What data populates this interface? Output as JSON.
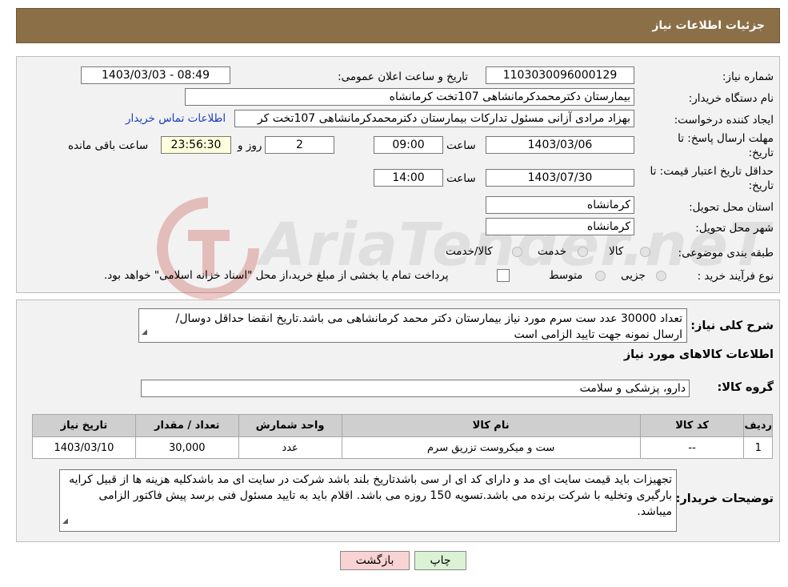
{
  "window": {
    "title": "جزئیات اطلاعات نیاز"
  },
  "form": {
    "need_number_label": "شماره نیاز:",
    "need_number": "1103030096000129",
    "announce_label": "تاریخ و ساعت اعلان عمومی:",
    "announce_value": "1403/03/03 - 08:49",
    "buyer_label": "نام دستگاه خریدار:",
    "buyer_value": "بیمارستان دکترمحمدکرمانشاهی 107تخت کرمانشاه",
    "creator_label": "ایجاد کننده درخواست:",
    "creator_value": "بهزاد مرادی آزانی مسئول تدارکات بیمارستان دکترمحمدکرمانشاهی 107تخت کر",
    "contact_link": "اطلاعات تماس خریدار",
    "deadline_label_1": "مهلت ارسال پاسخ: تا",
    "deadline_label_2": "تاریخ:",
    "deadline_date": "1403/03/06",
    "time_label": "ساعت",
    "deadline_time": "09:00",
    "days_value": "2",
    "days_label": "روز و",
    "remaining_time": "23:56:30",
    "remaining_label": "ساعت باقی مانده",
    "validity_label_1": "حداقل تاریخ اعتبار قیمت: تا",
    "validity_label_2": "تاریخ:",
    "validity_date": "1403/07/30",
    "validity_time": "14:00",
    "province_label": "استان محل تحویل:",
    "province_value": "کرمانشاه",
    "city_label": "شهر محل تحویل:",
    "city_value": "کرمانشاه",
    "category_label": "طبقه بندی موضوعی:",
    "category_options": [
      "کالا",
      "خدمت",
      "کالا/خدمت"
    ],
    "process_label": "نوع فرآیند خرید :",
    "process_options": [
      "جزیی",
      "متوسط"
    ],
    "process_note": "پرداخت تمام یا بخشی از مبلغ خرید،از محل \"اسناد خزانه اسلامی\" خواهد بود."
  },
  "details": {
    "description_label": "شرح کلی نیاز:",
    "description": "تعداد 30000 عدد ست سرم مورد نیاز بیمارستان دکتر محمد کرمانشاهی می باشد.تاریخ انقضا حداقل دوسال/ ارسال نمونه جهت تایید الزامی است",
    "goods_info_title": "اطلاعات کالاهای مورد نیاز",
    "goods_group_label": "گروه کالا:",
    "goods_group": "دارو، پزشکی و سلامت",
    "table": {
      "headers": [
        "ردیف",
        "کد کالا",
        "نام کالا",
        "واحد شمارش",
        "تعداد / مقدار",
        "تاریخ نیاز"
      ],
      "rows": [
        [
          "1",
          "--",
          "ست و میکروست تزریق سرم",
          "عدد",
          "30,000",
          "1403/03/10"
        ]
      ]
    },
    "buyer_notes_label": "توضیحات خریدار:",
    "buyer_notes": "تجهیزات باید قیمت سایت ای مد و دارای کد ای ار سی باشدتاریخ بلند باشد شرکت در سایت ای مد باشدکلیه هزینه ها از قبیل کرایه بارگیری وتخلیه با شرکت برنده می باشد.تسویه 150 روزه می باشد. اقلام باید به تایید مسئول فنی برسد پیش فاکتور الزامی میباشد."
  },
  "buttons": {
    "print": "چاپ",
    "back": "بازگشت"
  },
  "watermark_text": "AriaTender.neT",
  "colors": {
    "titlebar": "#8b6f47",
    "back_button": "#f9d3d3",
    "print_button": "#dcf2d5",
    "link": "#1a3fbf"
  }
}
